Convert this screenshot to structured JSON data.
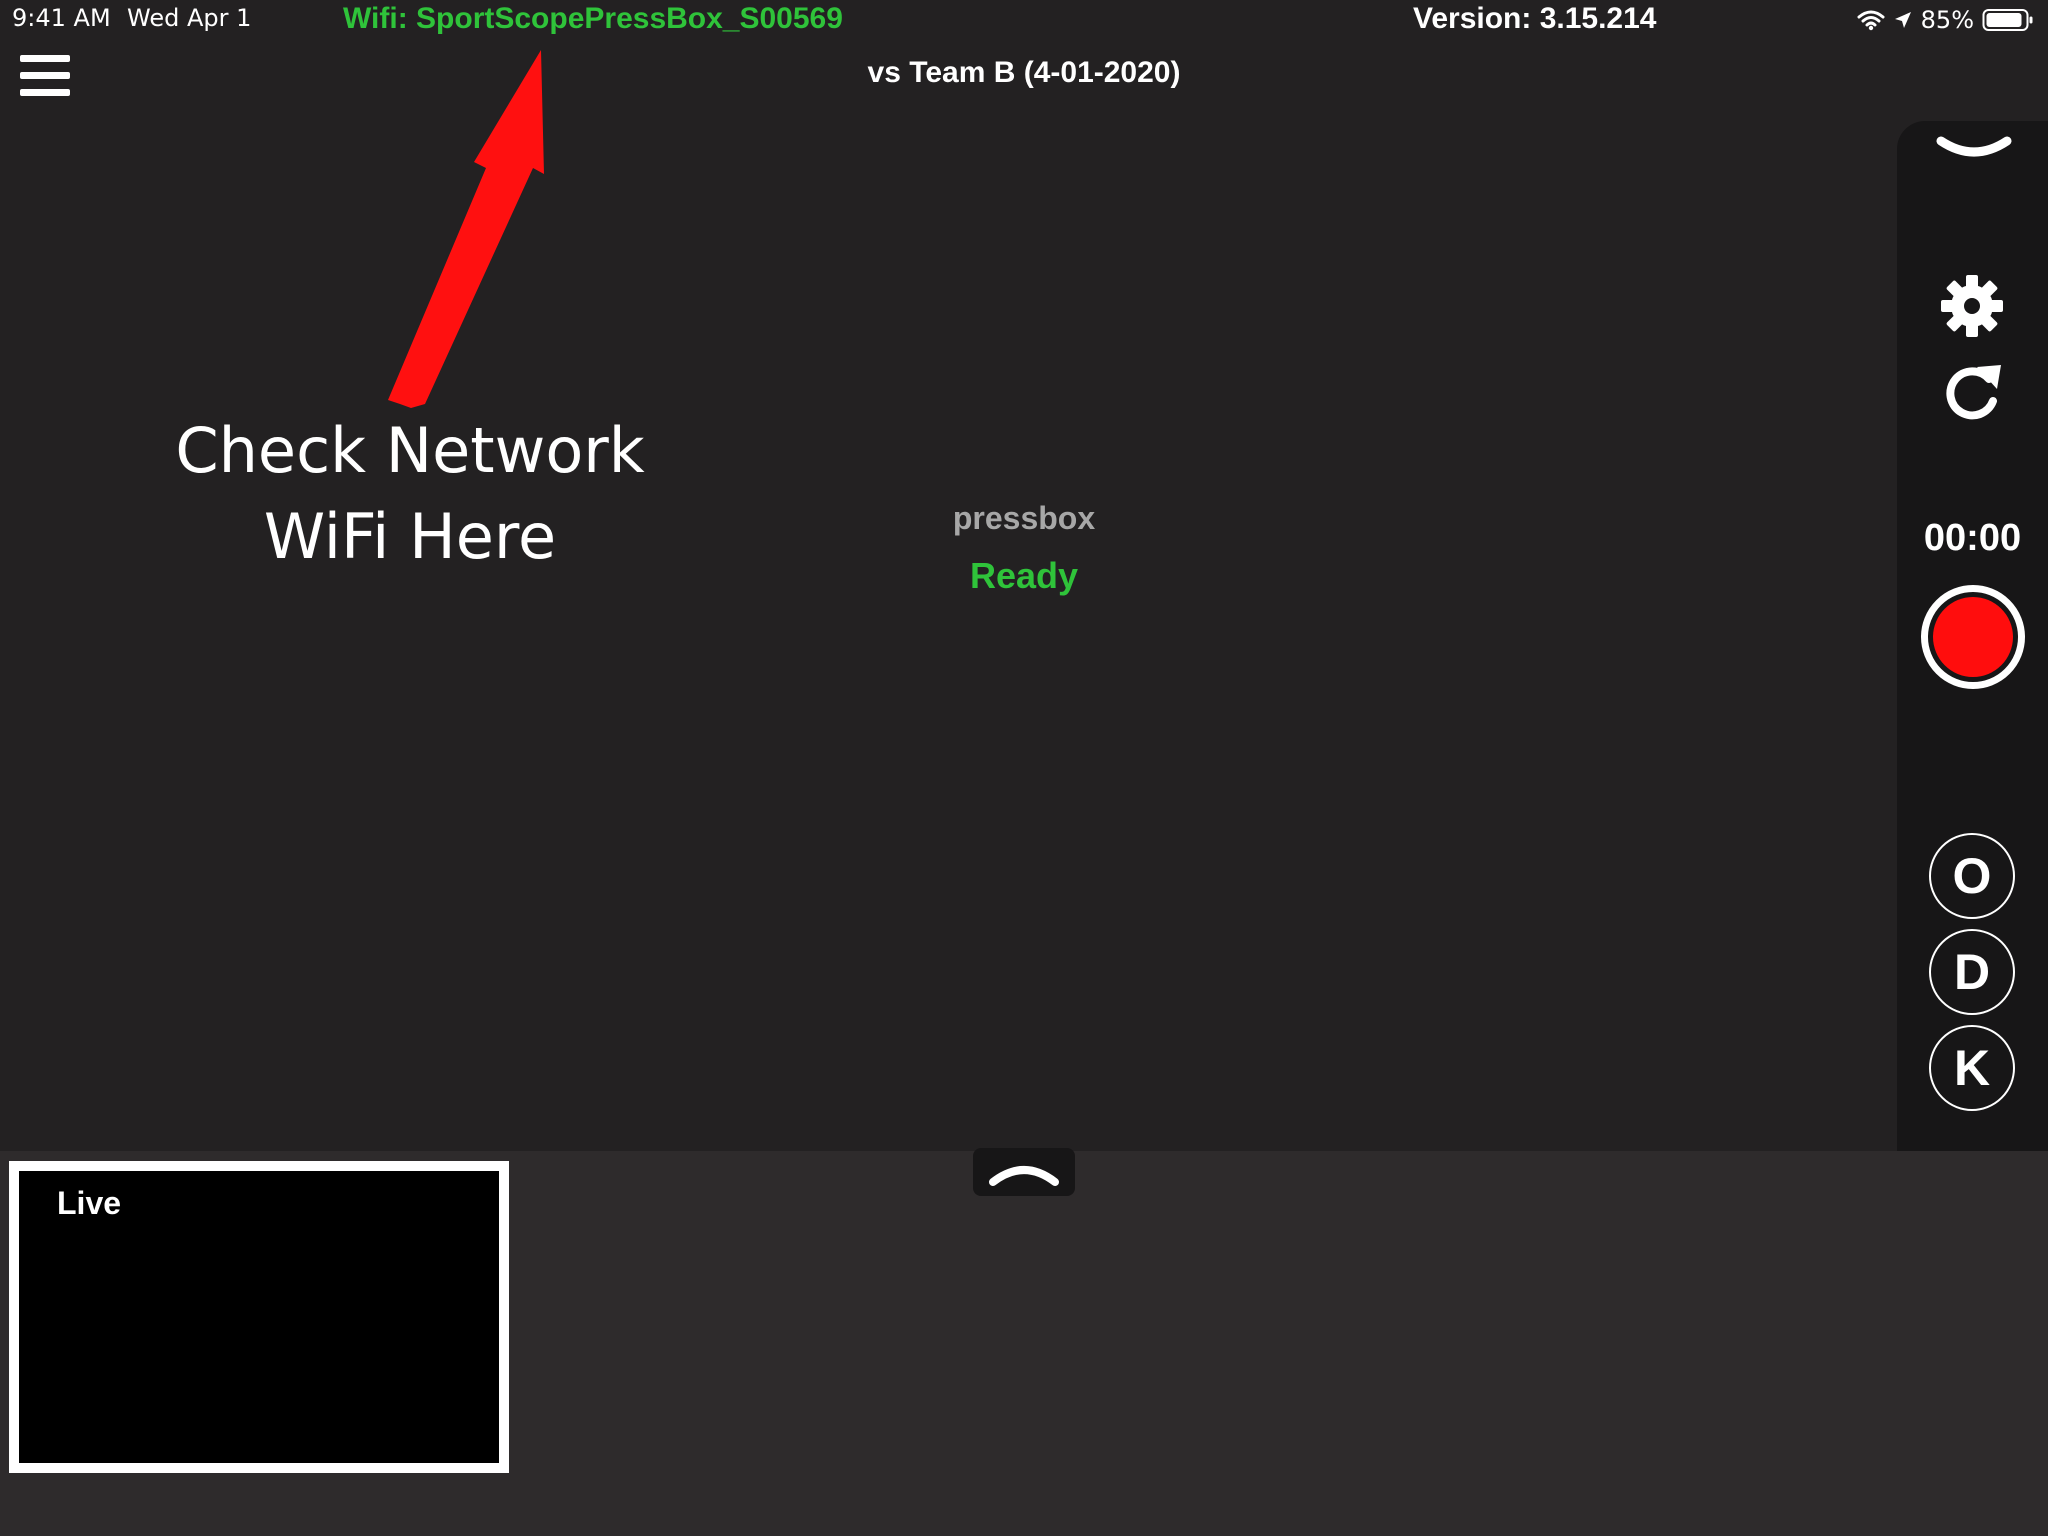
{
  "status_bar": {
    "time": "9:41 AM",
    "date": "Wed Apr 1",
    "wifi_name": "Wifi: SportScopePressBox_S00569",
    "version": "Version: 3.15.214",
    "battery": "85%"
  },
  "header": {
    "title": "vs Team B (4-01-2020)",
    "menu_icon": "hamburger-menu-icon"
  },
  "annotation": {
    "line1": "Check Network",
    "line2": "WiFi Here",
    "arrow_color": "#ff0000"
  },
  "center": {
    "name": "pressbox",
    "status": "Ready"
  },
  "right_panel": {
    "timer": "00:00",
    "modes": [
      "O",
      "D",
      "K"
    ],
    "icons": [
      "chevron-down-icon",
      "gear-icon",
      "refresh-icon",
      "record-icon"
    ]
  },
  "bottom": {
    "live_label": "Live",
    "expand_icon": "chevron-up-icon"
  },
  "colors": {
    "background": "#232122",
    "accent_green": "#2fc33a",
    "record_red": "#ff0d0d",
    "panel": "#171617",
    "tray": "#2e2b2c"
  }
}
